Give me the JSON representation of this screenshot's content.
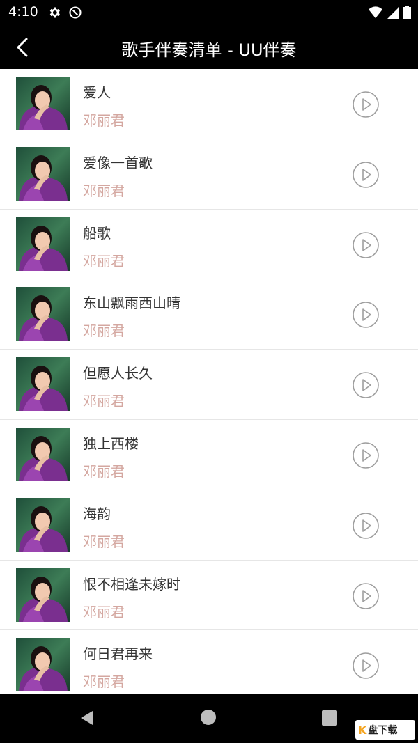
{
  "status_bar": {
    "time": "4:10",
    "icons_left": [
      "gear-icon",
      "at-sign-icon"
    ],
    "icons_right": [
      "wifi-icon",
      "signal-icon",
      "battery-icon"
    ]
  },
  "header": {
    "title": "歌手伴奏清单 - UU伴奏",
    "back_icon": "chevron-left-icon"
  },
  "songs": [
    {
      "title": "爱人",
      "artist": "邓丽君"
    },
    {
      "title": "爱像一首歌",
      "artist": "邓丽君"
    },
    {
      "title": "船歌",
      "artist": "邓丽君"
    },
    {
      "title": "东山飘雨西山晴",
      "artist": "邓丽君"
    },
    {
      "title": "但愿人长久",
      "artist": "邓丽君"
    },
    {
      "title": "独上西楼",
      "artist": "邓丽君"
    },
    {
      "title": "海韵",
      "artist": "邓丽君"
    },
    {
      "title": "恨不相逢未嫁时",
      "artist": "邓丽君"
    },
    {
      "title": "何日君再来",
      "artist": "邓丽君"
    }
  ],
  "nav_bar": {
    "icons": [
      "nav-back-icon",
      "nav-home-icon",
      "nav-recents-icon"
    ]
  },
  "watermark": {
    "text": "盘下载"
  },
  "colors": {
    "bar_background": "#000000",
    "title_text": "#333333",
    "artist_text": "#d4a7a0",
    "divider": "#e6e6e6",
    "play_icon": "#9e9e9e"
  }
}
